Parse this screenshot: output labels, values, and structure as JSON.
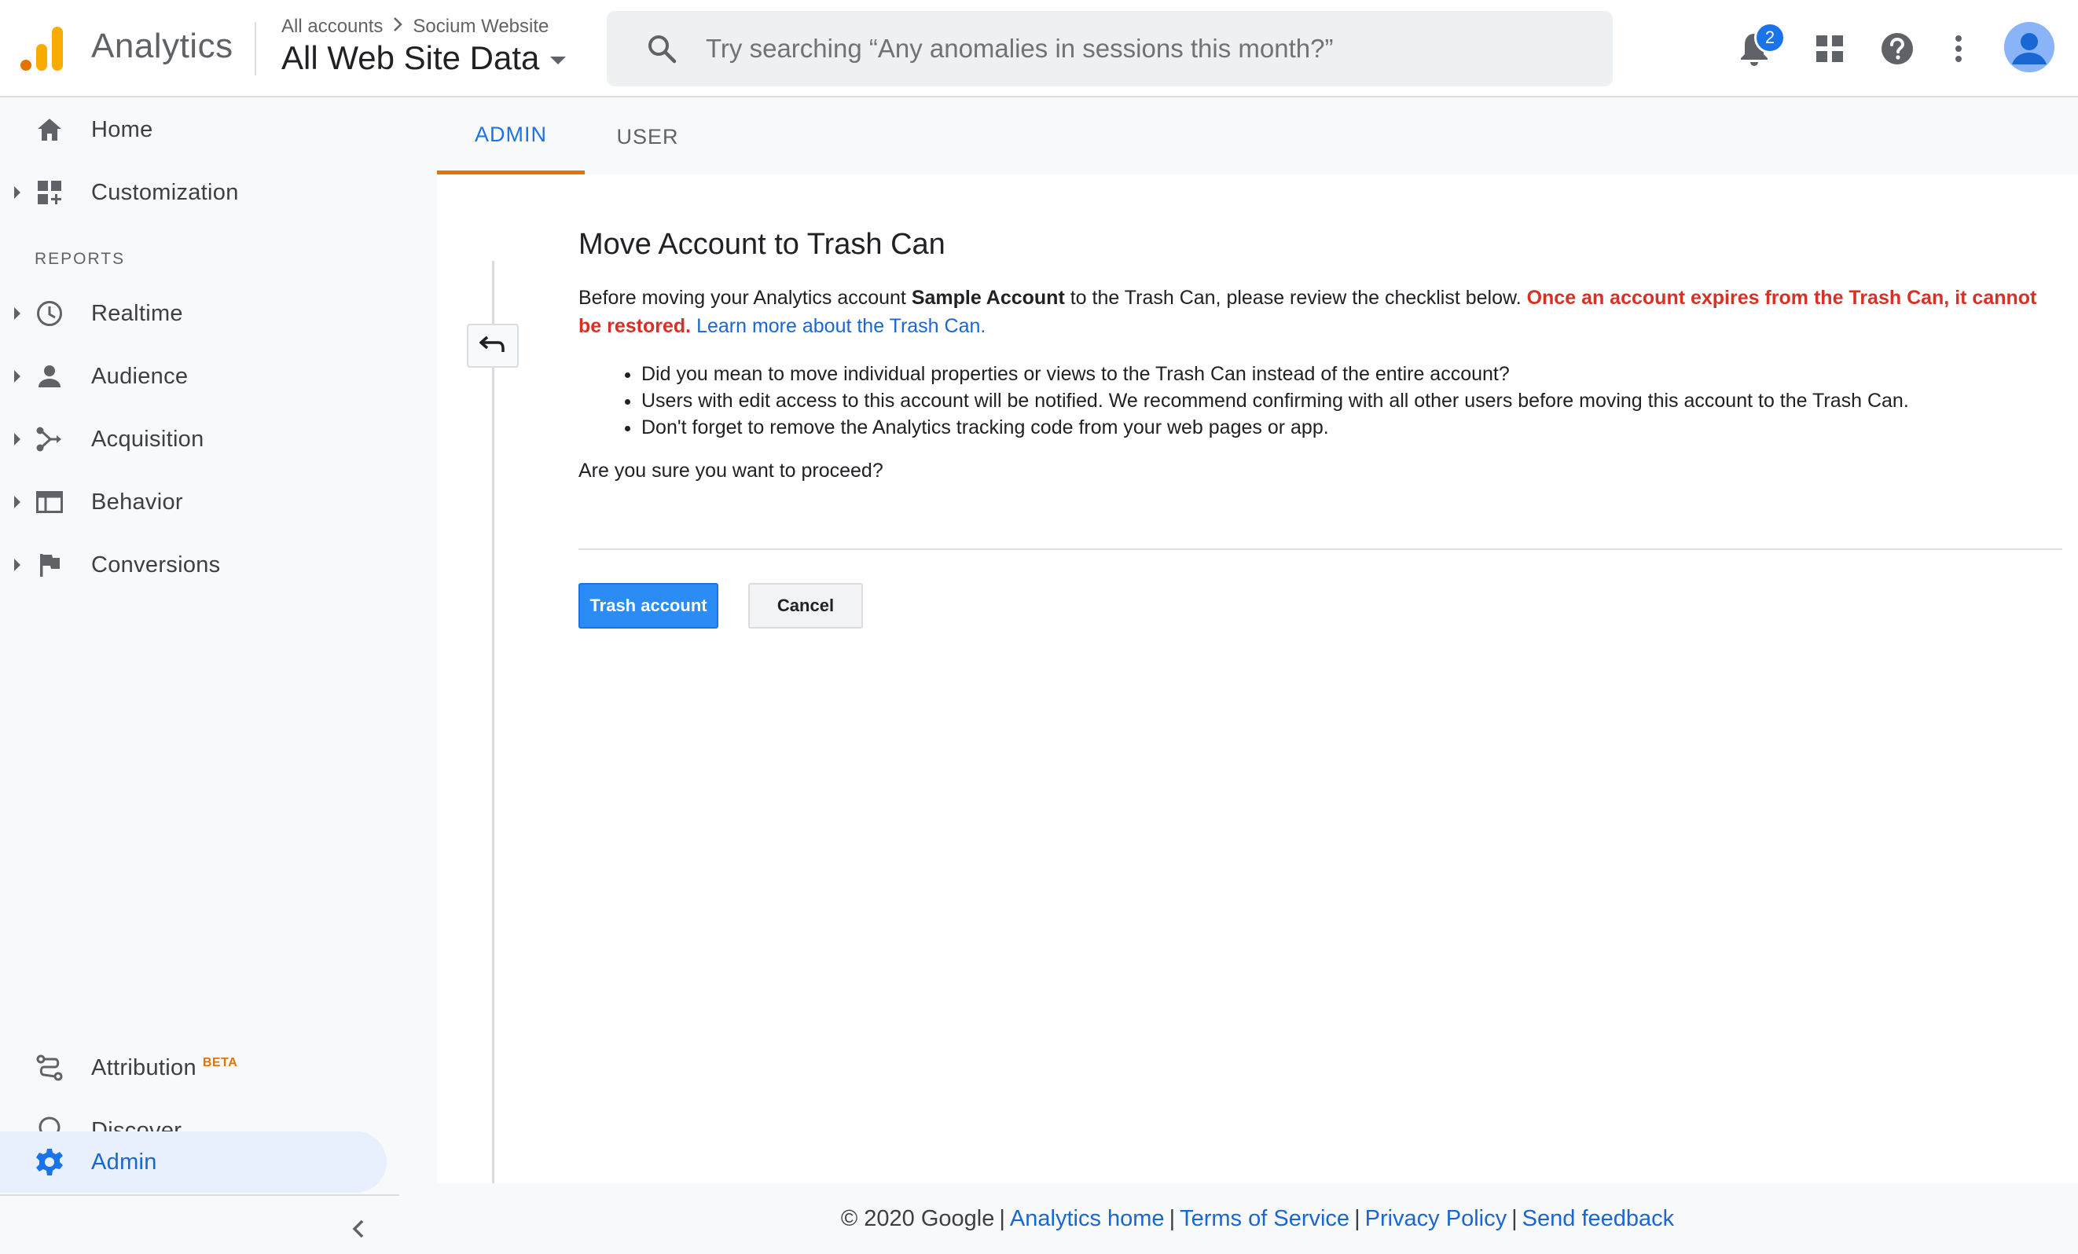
{
  "header": {
    "app_name": "Analytics",
    "breadcrumb": {
      "account": "All accounts",
      "property": "Socium Website"
    },
    "view_name": "All Web Site Data",
    "search": {
      "placeholder": "Try searching “Any anomalies in sessions this month?”",
      "value": ""
    },
    "notifications_count": "2",
    "icons": [
      "notifications-icon",
      "apps-icon",
      "help-icon",
      "more-vert-icon",
      "account-avatar"
    ]
  },
  "sidebar": {
    "home": "Home",
    "customization": "Customization",
    "reports_heading": "REPORTS",
    "realtime": "Realtime",
    "audience": "Audience",
    "acquisition": "Acquisition",
    "behavior": "Behavior",
    "conversions": "Conversions",
    "attribution": "Attribution",
    "attribution_badge": "BETA",
    "discover": "Discover",
    "admin": "Admin"
  },
  "tabs": {
    "admin": "ADMIN",
    "user": "USER",
    "active": "ADMIN"
  },
  "dialog": {
    "title": "Move Account to Trash Can",
    "intro_prefix": "Before moving your Analytics account ",
    "account_name": "Sample Account",
    "intro_suffix": " to the Trash Can, please review the checklist below. ",
    "warning": "Once an account expires from the Trash Can, it cannot be restored.",
    "learn_more": "Learn more about the Trash Can.",
    "checklist": [
      "Did you mean to move individual properties or views to the Trash Can instead of the entire account?",
      "Users with edit access to this account will be notified. We recommend confirming with all other users before moving this account to the Trash Can.",
      "Don't forget to remove the Analytics tracking code from your web pages or app."
    ],
    "question": "Are you sure you want to proceed?",
    "primary_button": "Trash account",
    "secondary_button": "Cancel"
  },
  "footer": {
    "copyright": "© 2020 Google",
    "links": [
      "Analytics home",
      "Terms of Service",
      "Privacy Policy",
      "Send feedback"
    ],
    "separator": "|"
  },
  "colors": {
    "accent": "#1a73e8",
    "warning": "#d93025",
    "tab_indicator": "#e37400",
    "active_nav_bg": "#e8f0fe"
  }
}
